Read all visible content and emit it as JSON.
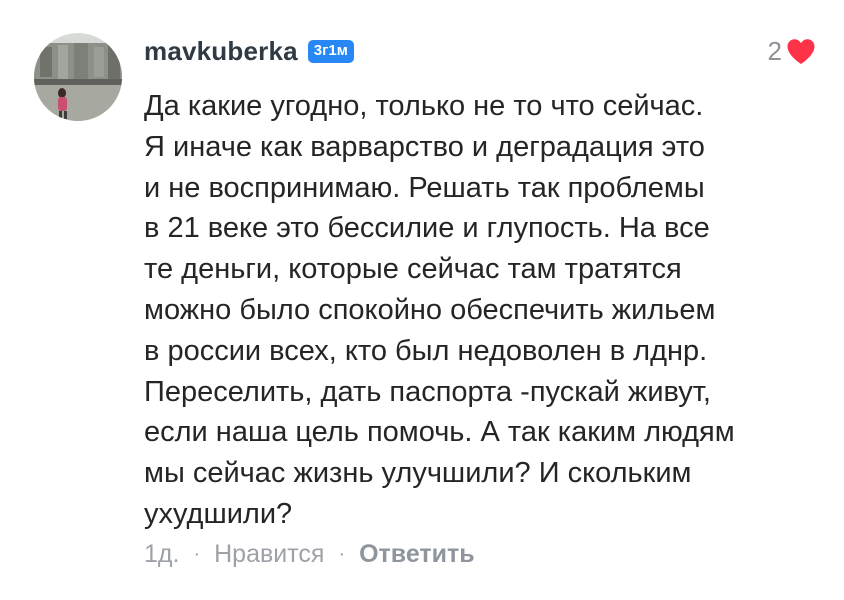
{
  "comment": {
    "author": "mavkuberka",
    "badge": "3г1м",
    "like_count": "2",
    "liked": true,
    "text_lines": [
      "Да какие угодно, только не то что сейчас.",
      "Я иначе как варварство и деградация это",
      "и не воспринимаю. Решать так проблемы",
      "в 21 веке это бессилие и глупость. На все",
      "те деньги, которые сейчас там тратятся",
      "можно было спокойно обеспечить жильем",
      "в россии всех, кто был недоволен в лднр.",
      "Переселить, дать паспорта -пускай живут,",
      "если наша цель помочь. А так каким людям",
      "мы сейчас жизнь улучшили? И скольким",
      "ухудшили?"
    ],
    "footer": {
      "time": "1д.",
      "separator": "·",
      "like_label": "Нравится",
      "reply_label": "Ответить"
    }
  },
  "colors": {
    "badge_bg": "#2787f5",
    "heart": "#ff3347",
    "author": "#2f3a44",
    "muted": "#9ea2a8"
  },
  "icons": {
    "like": "heart-icon",
    "avatar": "user-avatar-photo"
  }
}
